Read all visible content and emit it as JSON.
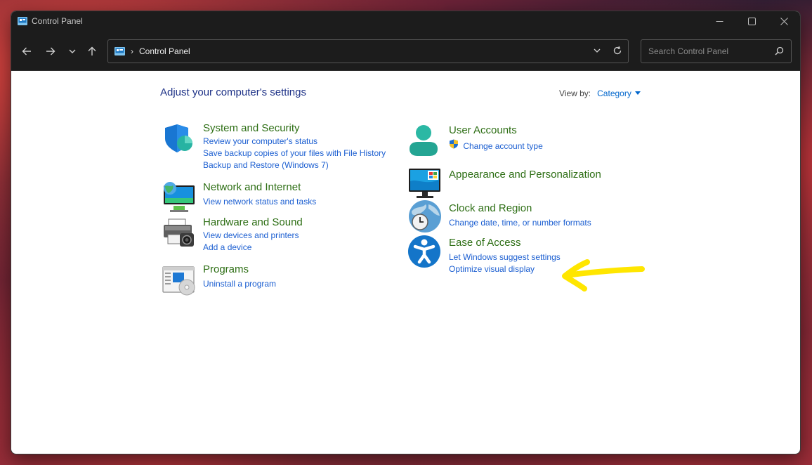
{
  "window": {
    "title": "Control Panel"
  },
  "address": {
    "crumb": "Control Panel"
  },
  "search": {
    "placeholder": "Search Control Panel"
  },
  "main": {
    "heading": "Adjust your computer's settings",
    "view_by_label": "View by:",
    "view_by_value": "Category"
  },
  "categories_left": [
    {
      "title": "System and Security",
      "icon": "shield-icon",
      "links": [
        "Review your computer's status",
        "Save backup copies of your files with File History",
        "Backup and Restore (Windows 7)"
      ]
    },
    {
      "title": "Network and Internet",
      "icon": "network-icon",
      "links": [
        "View network status and tasks"
      ]
    },
    {
      "title": "Hardware and Sound",
      "icon": "printer-icon",
      "links": [
        "View devices and printers",
        "Add a device"
      ]
    },
    {
      "title": "Programs",
      "icon": "programs-icon",
      "links": [
        "Uninstall a program"
      ]
    }
  ],
  "categories_right": [
    {
      "title": "User Accounts",
      "icon": "user-icon",
      "links": [
        "Change account type"
      ]
    },
    {
      "title": "Appearance and Personalization",
      "icon": "monitor-icon",
      "links": []
    },
    {
      "title": "Clock and Region",
      "icon": "clock-globe-icon",
      "links": [
        "Change date, time, or number formats"
      ]
    },
    {
      "title": "Ease of Access",
      "icon": "accessibility-icon",
      "links": [
        "Let Windows suggest settings",
        "Optimize visual display"
      ]
    }
  ],
  "annotation": {
    "color": "#ffe600",
    "icon": "arrow-left-icon"
  }
}
